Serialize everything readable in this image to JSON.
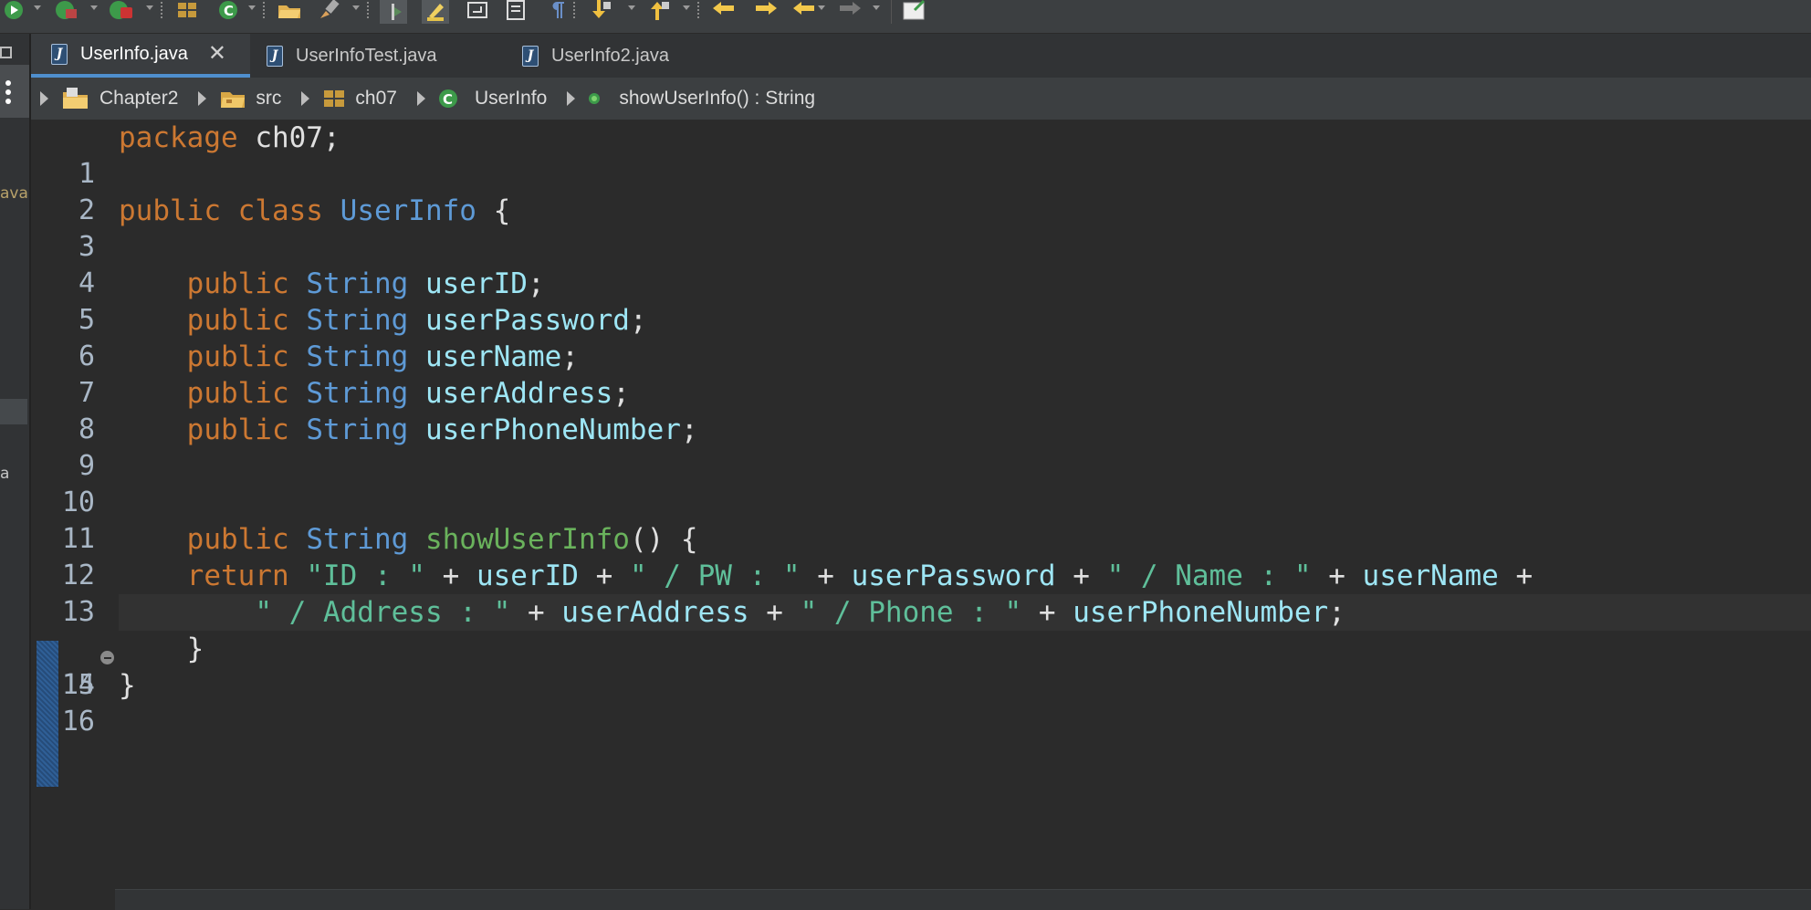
{
  "colors": {
    "keyword": "#cc7832",
    "type": "#5e9ad6",
    "field": "#9ee6f5",
    "method": "#6ab25c",
    "string": "#5fbf9a",
    "plain": "#e0e0e0",
    "active_tab_underline": "#4f8fce"
  },
  "toolbar": {
    "icons": [
      "run-icon",
      "debug-icon",
      "coverage-icon",
      "package-icon",
      "new-class-icon",
      "open-folder-icon",
      "brush-icon",
      "toggle-mark-icon",
      "highlight-icon",
      "return-icon",
      "block-icon",
      "pilcrow-icon",
      "next-annotation-icon",
      "prev-annotation-icon",
      "back-icon",
      "forward-icon",
      "last-edit-icon",
      "forward-disabled-icon",
      "external-icon"
    ]
  },
  "sidebar": {
    "fragment_1": "ava",
    "fragment_2": "a"
  },
  "tabs": [
    {
      "label": "UserInfo.java",
      "active": true
    },
    {
      "label": "UserInfoTest.java",
      "active": false
    },
    {
      "label": "UserInfo2.java",
      "active": false
    }
  ],
  "breadcrumb": {
    "project": "Chapter2",
    "folder": "src",
    "package": "ch07",
    "class": "UserInfo",
    "method": "showUserInfo() : String"
  },
  "code": {
    "line_numbers": [
      "1",
      "2",
      "3",
      "4",
      "5",
      "6",
      "7",
      "8",
      "9",
      "10",
      "11",
      "12",
      "13",
      "14",
      "15",
      "16"
    ],
    "l1": {
      "kw": "package",
      "rest": " ch07;"
    },
    "l3": {
      "kw1": "public",
      "kw2": "class",
      "name": "UserInfo",
      "rest": " {"
    },
    "fields": [
      {
        "kw": "public",
        "type": "String",
        "name": "userID",
        "end": ";"
      },
      {
        "kw": "public",
        "type": "String",
        "name": "userPassword",
        "end": ";"
      },
      {
        "kw": "public",
        "type": "String",
        "name": "userName",
        "end": ";"
      },
      {
        "kw": "public",
        "type": "String",
        "name": "userAddress",
        "end": ";"
      },
      {
        "kw": "public",
        "type": "String",
        "name": "userPhoneNumber",
        "end": ";"
      }
    ],
    "l12": {
      "kw": "public",
      "type": "String",
      "method": "showUserInfo",
      "rest": "() {"
    },
    "l13": {
      "kw": "return",
      "s1": "\"ID : \"",
      "p1": " + ",
      "f1": "userID",
      "p2": " + ",
      "s2": "\" / PW : \"",
      "p3": " + ",
      "f2": "userPassword",
      "p4": " + ",
      "s3": "\" / Name : \"",
      "p5": " + ",
      "f3": "userName",
      "p6": " +"
    },
    "l14": {
      "s1": "\" / Address : \"",
      "p1": " + ",
      "f1": "userAddress",
      "p2": " + ",
      "s2": "\" / Phone : \"",
      "p3": " + ",
      "f2": "userPhoneNumber",
      "end": ";"
    },
    "l15": "}",
    "l16": "}"
  }
}
